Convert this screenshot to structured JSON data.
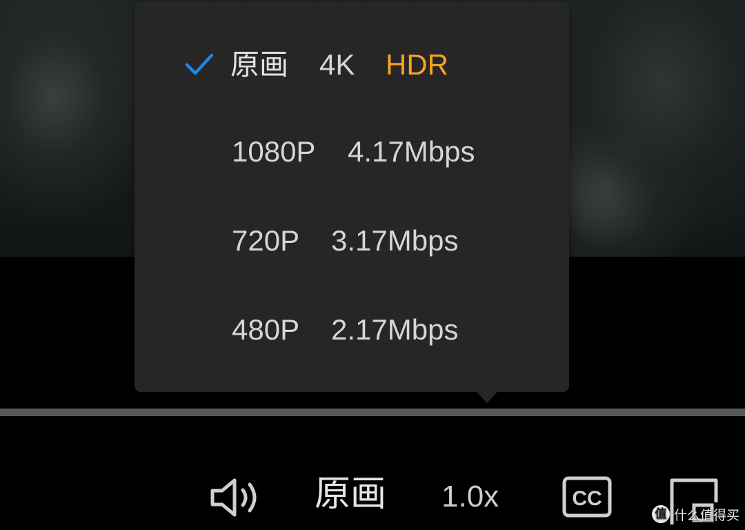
{
  "quality_menu": {
    "selected_index": 0,
    "items": [
      {
        "resolution": "原画",
        "detail": "4K",
        "tag": "HDR",
        "selected": true
      },
      {
        "resolution": "1080P",
        "detail": "4.17Mbps",
        "selected": false
      },
      {
        "resolution": "720P",
        "detail": "3.17Mbps",
        "selected": false
      },
      {
        "resolution": "480P",
        "detail": "2.17Mbps",
        "selected": false
      }
    ]
  },
  "controls": {
    "volume_icon": "speaker-volume-icon",
    "quality_label": "原画",
    "speed_label": "1.0x",
    "cc_label": "CC",
    "cc_icon": "closed-captions-icon",
    "pip_icon": "picture-in-picture-icon"
  },
  "watermark": {
    "badge": "值",
    "text": "什么值得买"
  },
  "colors": {
    "menu_background": "#262626",
    "check_mark": "#1e88e5",
    "hdr_tag": "#f5a41f",
    "progress_track": "#5a5a5a",
    "text_primary": "#d6d6d6"
  }
}
